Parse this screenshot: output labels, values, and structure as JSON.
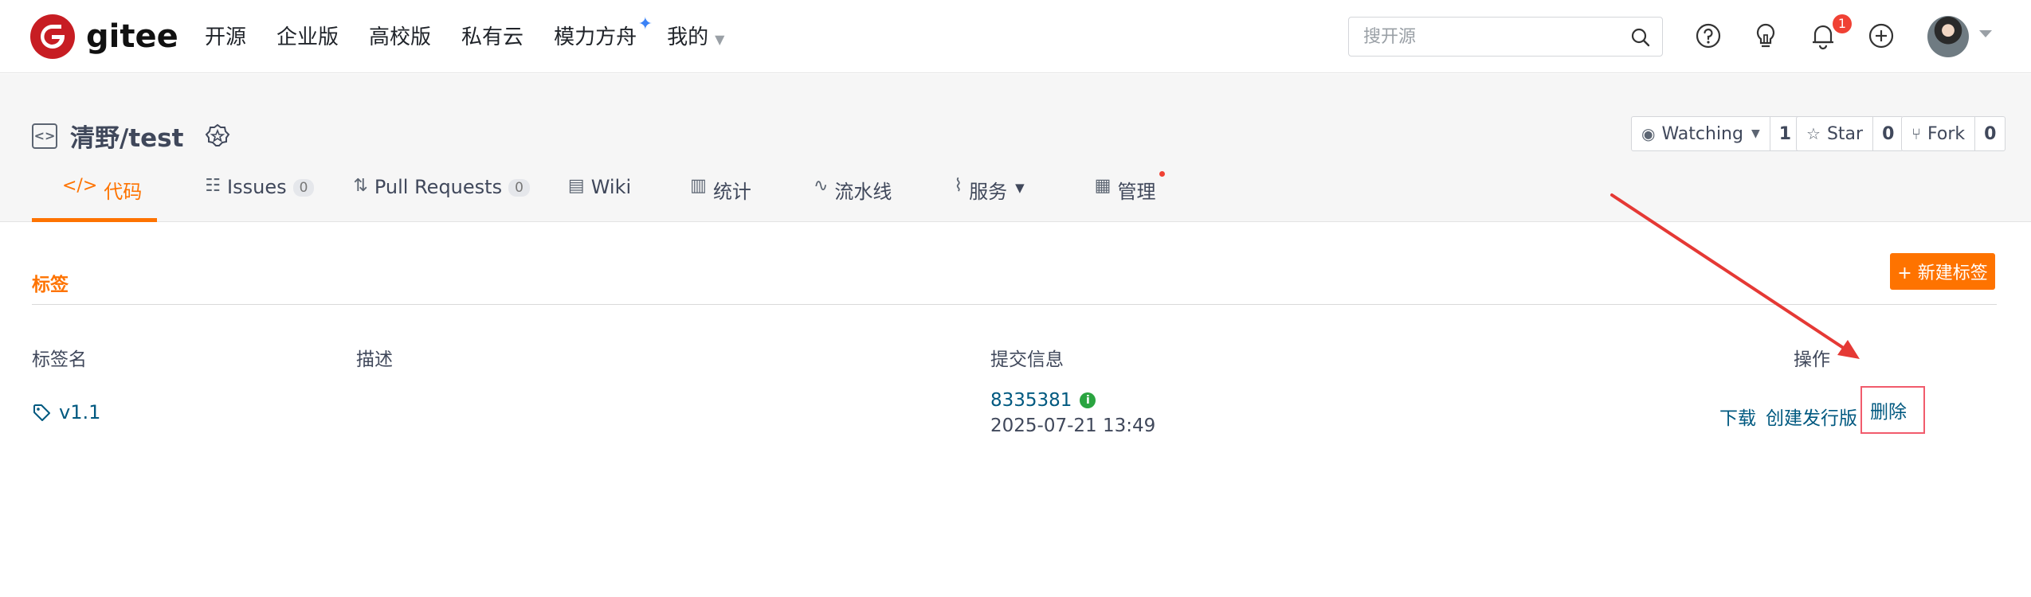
{
  "brand": {
    "name": "gitee",
    "color": "#c71d23"
  },
  "topnav": {
    "links": [
      {
        "label": "开源"
      },
      {
        "label": "企业版"
      },
      {
        "label": "高校版"
      },
      {
        "label": "私有云"
      },
      {
        "label": "模力方舟"
      },
      {
        "label": "我的"
      }
    ],
    "search_placeholder": "搜开源",
    "notification_count": "1",
    "icons": [
      "search-icon",
      "help-icon",
      "lightbulb-icon",
      "bell-icon",
      "plus-icon",
      "avatar"
    ]
  },
  "repo": {
    "name": "清野/test",
    "watch": {
      "label": "Watching",
      "count": "1"
    },
    "star": {
      "label": "Star",
      "count": "0"
    },
    "fork": {
      "label": "Fork",
      "count": "0"
    }
  },
  "tabs": [
    {
      "label": "代码",
      "active": true
    },
    {
      "label": "Issues",
      "count": "0"
    },
    {
      "label": "Pull Requests",
      "count": "0"
    },
    {
      "label": "Wiki"
    },
    {
      "label": "统计"
    },
    {
      "label": "流水线"
    },
    {
      "label": "服务"
    },
    {
      "label": "管理"
    }
  ],
  "tags_page": {
    "title": "标签",
    "new_button": "+ 新建标签",
    "columns": [
      "标签名",
      "描述",
      "提交信息",
      "操作"
    ],
    "rows": [
      {
        "name": "v1.1",
        "description": "",
        "commit_hash": "8335381",
        "commit_time": "2025-07-21 13:49",
        "actions": {
          "download": "下载",
          "create_release": "创建发行版",
          "delete": "删除"
        }
      }
    ]
  },
  "accent_colors": {
    "primary": "#fe7300",
    "link": "#005980",
    "annotation": "#e53935"
  }
}
